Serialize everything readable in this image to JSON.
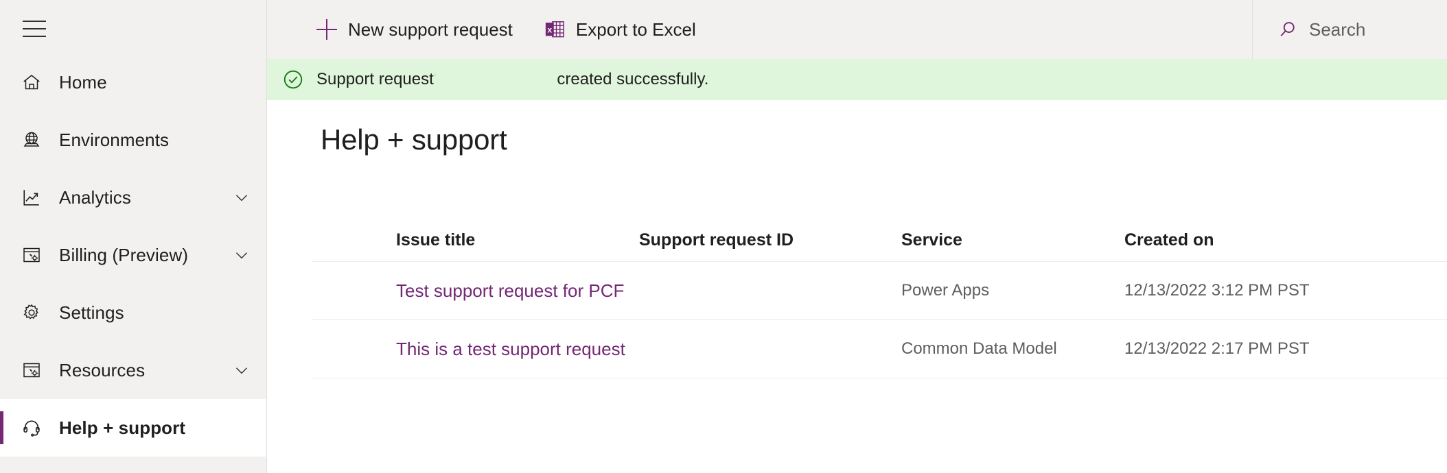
{
  "sidebar": {
    "menu_icon": "hamburger-icon",
    "items": [
      {
        "label": "Home",
        "icon": "home-icon",
        "expandable": false,
        "selected": false
      },
      {
        "label": "Environments",
        "icon": "globe-icon",
        "expandable": false,
        "selected": false
      },
      {
        "label": "Analytics",
        "icon": "chart-line-icon",
        "expandable": true,
        "selected": false
      },
      {
        "label": "Billing (Preview)",
        "icon": "billing-icon",
        "expandable": true,
        "selected": false
      },
      {
        "label": "Settings",
        "icon": "gear-icon",
        "expandable": false,
        "selected": false
      },
      {
        "label": "Resources",
        "icon": "resources-icon",
        "expandable": true,
        "selected": false
      },
      {
        "label": "Help + support",
        "icon": "headset-icon",
        "expandable": false,
        "selected": true
      }
    ]
  },
  "commandbar": {
    "new_request_label": "New support request",
    "new_request_icon": "plus-icon",
    "export_excel_label": "Export to Excel",
    "export_excel_icon": "excel-icon"
  },
  "search": {
    "icon": "search-icon",
    "placeholder": "Search",
    "value": ""
  },
  "message": {
    "icon": "checkmark-circle-icon",
    "text": "Support request",
    "quoted_name": "'",
    "suffix": "created successfully."
  },
  "page": {
    "title": "Help + support"
  },
  "table": {
    "columns": [
      "Issue title",
      "Support request ID",
      "Service",
      "Created on"
    ],
    "rows": [
      {
        "issue_title": "Test support request for PCF",
        "support_request_id": "",
        "service": "Power Apps",
        "created_on": "12/13/2022 3:12 PM PST"
      },
      {
        "issue_title": "This is a test support request",
        "support_request_id": "",
        "service": "Common Data Model",
        "created_on": "12/13/2022 2:17 PM PST"
      }
    ]
  },
  "colors": {
    "accent_purple": "#742774",
    "sidebar_bg": "#f2f1f0",
    "success_bg": "#dff6dd",
    "success_green": "#107c10",
    "link_purple": "#742774",
    "text_primary": "#201f1e",
    "text_secondary": "#605e5c"
  }
}
